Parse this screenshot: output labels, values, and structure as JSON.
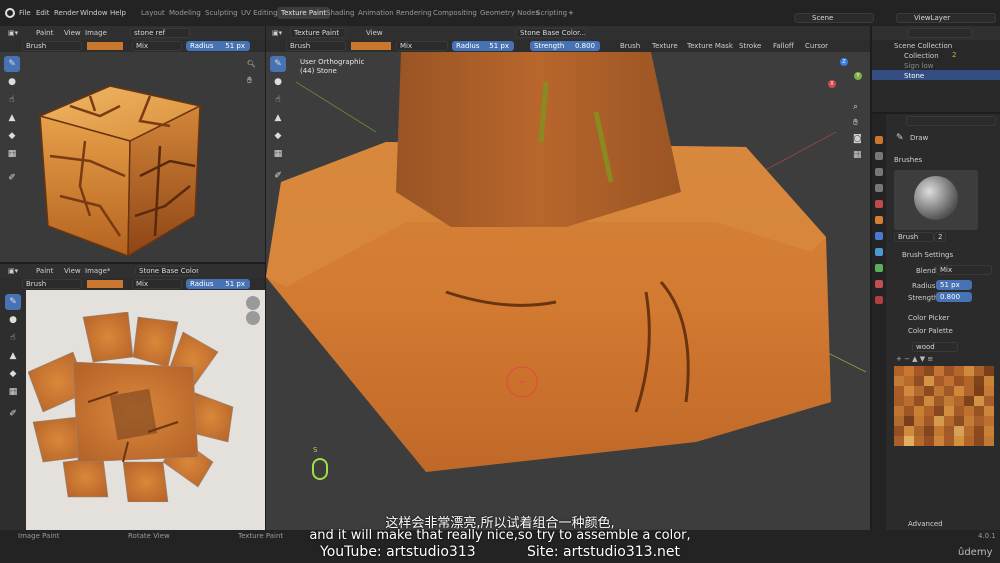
{
  "topbar": {
    "menu": [
      "File",
      "Edit",
      "Render",
      "Window",
      "Help"
    ],
    "workspaces": [
      "Layout",
      "Modeling",
      "Sculpting",
      "UV Editing",
      "Texture Paint",
      "Shading",
      "Animation",
      "Rendering",
      "Compositing",
      "Geometry Nodes",
      "Scripting"
    ],
    "active_workspace": "Texture Paint",
    "scene": "Scene",
    "view_layer": "ViewLayer"
  },
  "image_editor_top": {
    "mode": "Paint",
    "view": "View",
    "image": "Image",
    "image_name": "stone ref",
    "brush": "Brush",
    "blend": "Mix",
    "radius_label": "Radius",
    "radius_value": "51 px"
  },
  "image_editor_bottom": {
    "mode": "Paint",
    "view": "View",
    "image": "Image*",
    "image_name": "Stone Base Color.001",
    "brush": "Brush",
    "blend": "Mix",
    "radius_label": "Radius",
    "radius_value": "51 px"
  },
  "viewport": {
    "mode": "Texture Paint",
    "view": "View",
    "texture": "Stone Base Color...",
    "brush": "Brush",
    "blend": "Mix",
    "radius_label": "Radius",
    "radius_value": "51 px",
    "strength_label": "Strength",
    "strength_value": "0.800",
    "menus": [
      "Brush",
      "Texture",
      "Texture Mask",
      "Stroke",
      "Falloff",
      "Cursor"
    ],
    "overlay_title": "User Orthographic",
    "overlay_subtitle": "(44) Stone",
    "key_hint": "S",
    "axes": {
      "x": "X",
      "y": "Y",
      "z": "Z"
    }
  },
  "outliner": {
    "items": [
      {
        "label": "Scene Collection"
      },
      {
        "label": "Collection"
      },
      {
        "label": "Sign low"
      },
      {
        "label": "Stone"
      }
    ],
    "collection_badge": "2"
  },
  "properties": {
    "tool": "Draw",
    "brushes_header": "Brushes",
    "brush_name": "Brush",
    "brush_users": "2",
    "brush_settings_header": "Brush Settings",
    "blend_label": "Blend",
    "blend_value": "Mix",
    "radius_label": "Radius",
    "radius_value": "51 px",
    "strength_label": "Strength",
    "strength_value": "0.800",
    "color_picker": "Color Picker",
    "color_palette": "Color Palette",
    "palette_name": "wood",
    "advanced": "Advanced",
    "palette_colors": [
      "#b0622a",
      "#c9762f",
      "#a35826",
      "#8a4a1f",
      "#c27433",
      "#9b5325",
      "#b5662b",
      "#d08a3b",
      "#a8602a",
      "#7a4019",
      "#c57a37",
      "#b86b2d",
      "#8f4f22",
      "#d59445",
      "#a85a27",
      "#c27030",
      "#9a5224",
      "#b36528",
      "#7f431c",
      "#c98237",
      "#a95d29",
      "#cf8a3f",
      "#b46a2e",
      "#8c4a1f",
      "#c07536",
      "#9f5827",
      "#d0873a",
      "#b0652b",
      "#7b3f18",
      "#c47a33",
      "#a55c27",
      "#ba6d2f",
      "#93501f",
      "#cd8a3e",
      "#a05a28",
      "#c27b37",
      "#b2662c",
      "#7e431b",
      "#d39246",
      "#a85e2a",
      "#bf7433",
      "#9d5727",
      "#c98035",
      "#af632b",
      "#874820",
      "#d18d40",
      "#a35b28",
      "#bd7131",
      "#985322",
      "#ca8639",
      "#b06a2e",
      "#7a3f1a",
      "#c47933",
      "#a15829",
      "#d49b4e",
      "#b4692d",
      "#8e4d21",
      "#c57d36",
      "#a75e2a",
      "#bb7030",
      "#964f22",
      "#cf8c3e",
      "#ab622b",
      "#824520",
      "#c3782f",
      "#a35a27",
      "#d5a25a",
      "#b76b2e",
      "#8b4a20",
      "#c88038",
      "#a85f29",
      "#e0b060",
      "#b56a2c",
      "#934f23",
      "#cb843a",
      "#a45b28",
      "#d2923f",
      "#b06529",
      "#8a4920",
      "#c17834"
    ]
  },
  "status": {
    "left": "Image Paint",
    "mid1": "Rotate View",
    "mid2": "Texture Paint",
    "version": "4.0.1"
  },
  "captions": {
    "zh": "这样会非常漂亮,所以试着组合一种颜色,",
    "en": "and it will make that really nice,so try to assemble a color,",
    "youtube": "YouTube: artstudio313",
    "site": "Site: artstudio313.net",
    "udemy": "ûdemy"
  }
}
